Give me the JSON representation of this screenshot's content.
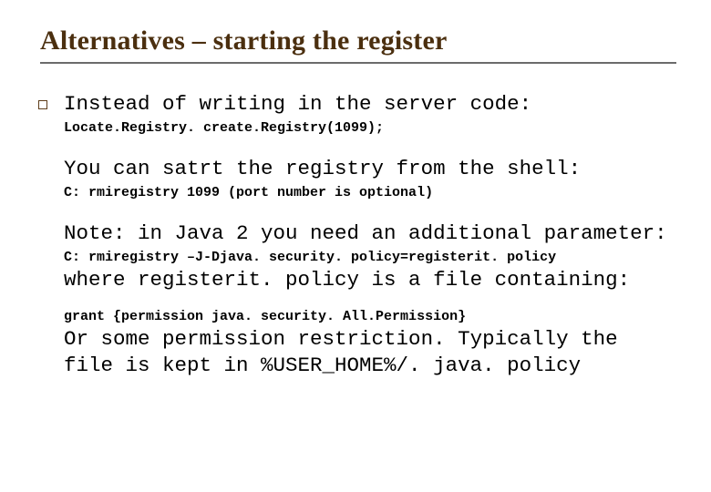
{
  "title": "Alternatives – starting the register",
  "body": {
    "line1": "Instead of writing in the server code:",
    "code1": "Locate.Registry. create.Registry(1099);",
    "line2": "You can satrt the registry from the shell:",
    "code2": "C: rmiregistry 1099 (port number is optional)",
    "line3": "Note: in Java 2 you need an additional parameter:",
    "code3": "C: rmiregistry –J-Djava. security. policy=registerit. policy",
    "line4": "where registerit. policy is a file containing:",
    "code4": "grant {permission java. security. All.Permission}",
    "line5": "Or some permission restriction. Typically the file is kept in %USER_HOME%/. java. policy"
  }
}
